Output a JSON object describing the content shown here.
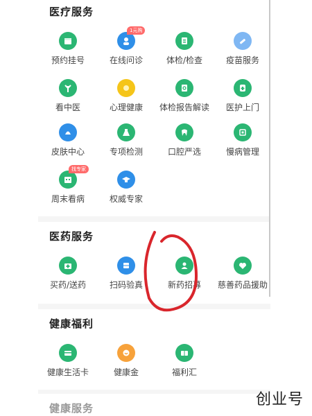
{
  "sections": {
    "medical": {
      "title": "医疗服务",
      "items": [
        {
          "label": "预约挂号",
          "icon": "calendar-icon",
          "color": "#2bb673"
        },
        {
          "label": "在线问诊",
          "icon": "doctor-icon",
          "color": "#2f8fe8",
          "badge": "1元购"
        },
        {
          "label": "体检/检查",
          "icon": "clipboard-icon",
          "color": "#2bb673"
        },
        {
          "label": "疫苗服务",
          "icon": "syringe-icon",
          "color": "#7fb7f3"
        },
        {
          "label": "看中医",
          "icon": "herb-icon",
          "color": "#2bb673"
        },
        {
          "label": "心理健康",
          "icon": "mind-icon",
          "color": "#f5c51a"
        },
        {
          "label": "体检报告解读",
          "icon": "report-icon",
          "color": "#2bb673"
        },
        {
          "label": "医护上门",
          "icon": "nurse-icon",
          "color": "#2bb673"
        },
        {
          "label": "皮肤中心",
          "icon": "skin-icon",
          "color": "#2f8fe8"
        },
        {
          "label": "专项检测",
          "icon": "flask-icon",
          "color": "#2bb673"
        },
        {
          "label": "口腔严选",
          "icon": "tooth-icon",
          "color": "#2bb673"
        },
        {
          "label": "慢病管理",
          "icon": "fortune-icon",
          "color": "#2bb673"
        },
        {
          "label": "周末看病",
          "icon": "weekend-calendar-icon",
          "color": "#2bb673",
          "badge": "找专家"
        },
        {
          "label": "权威专家",
          "icon": "graduation-cap-icon",
          "color": "#2f8fe8"
        }
      ]
    },
    "medicine": {
      "title": "医药服务",
      "items": [
        {
          "label": "买药/送药",
          "icon": "pharmacy-icon",
          "color": "#2bb673"
        },
        {
          "label": "扫码验真",
          "icon": "scan-icon",
          "color": "#2f8fe8"
        },
        {
          "label": "新药招募",
          "icon": "recruit-icon",
          "color": "#2bb673"
        },
        {
          "label": "慈善药品援助",
          "icon": "charity-heart-icon",
          "color": "#2bb673"
        }
      ]
    },
    "welfare": {
      "title": "健康福利",
      "items": [
        {
          "label": "健康生活卡",
          "icon": "card-icon",
          "color": "#2bb673"
        },
        {
          "label": "健康金",
          "icon": "coin-icon",
          "color": "#f7a23b"
        },
        {
          "label": "福利汇",
          "icon": "ticket-icon",
          "color": "#2bb673"
        }
      ]
    },
    "health": {
      "title": "健康服务"
    }
  },
  "watermark": "创业号",
  "annotation_color": "#d9262c"
}
